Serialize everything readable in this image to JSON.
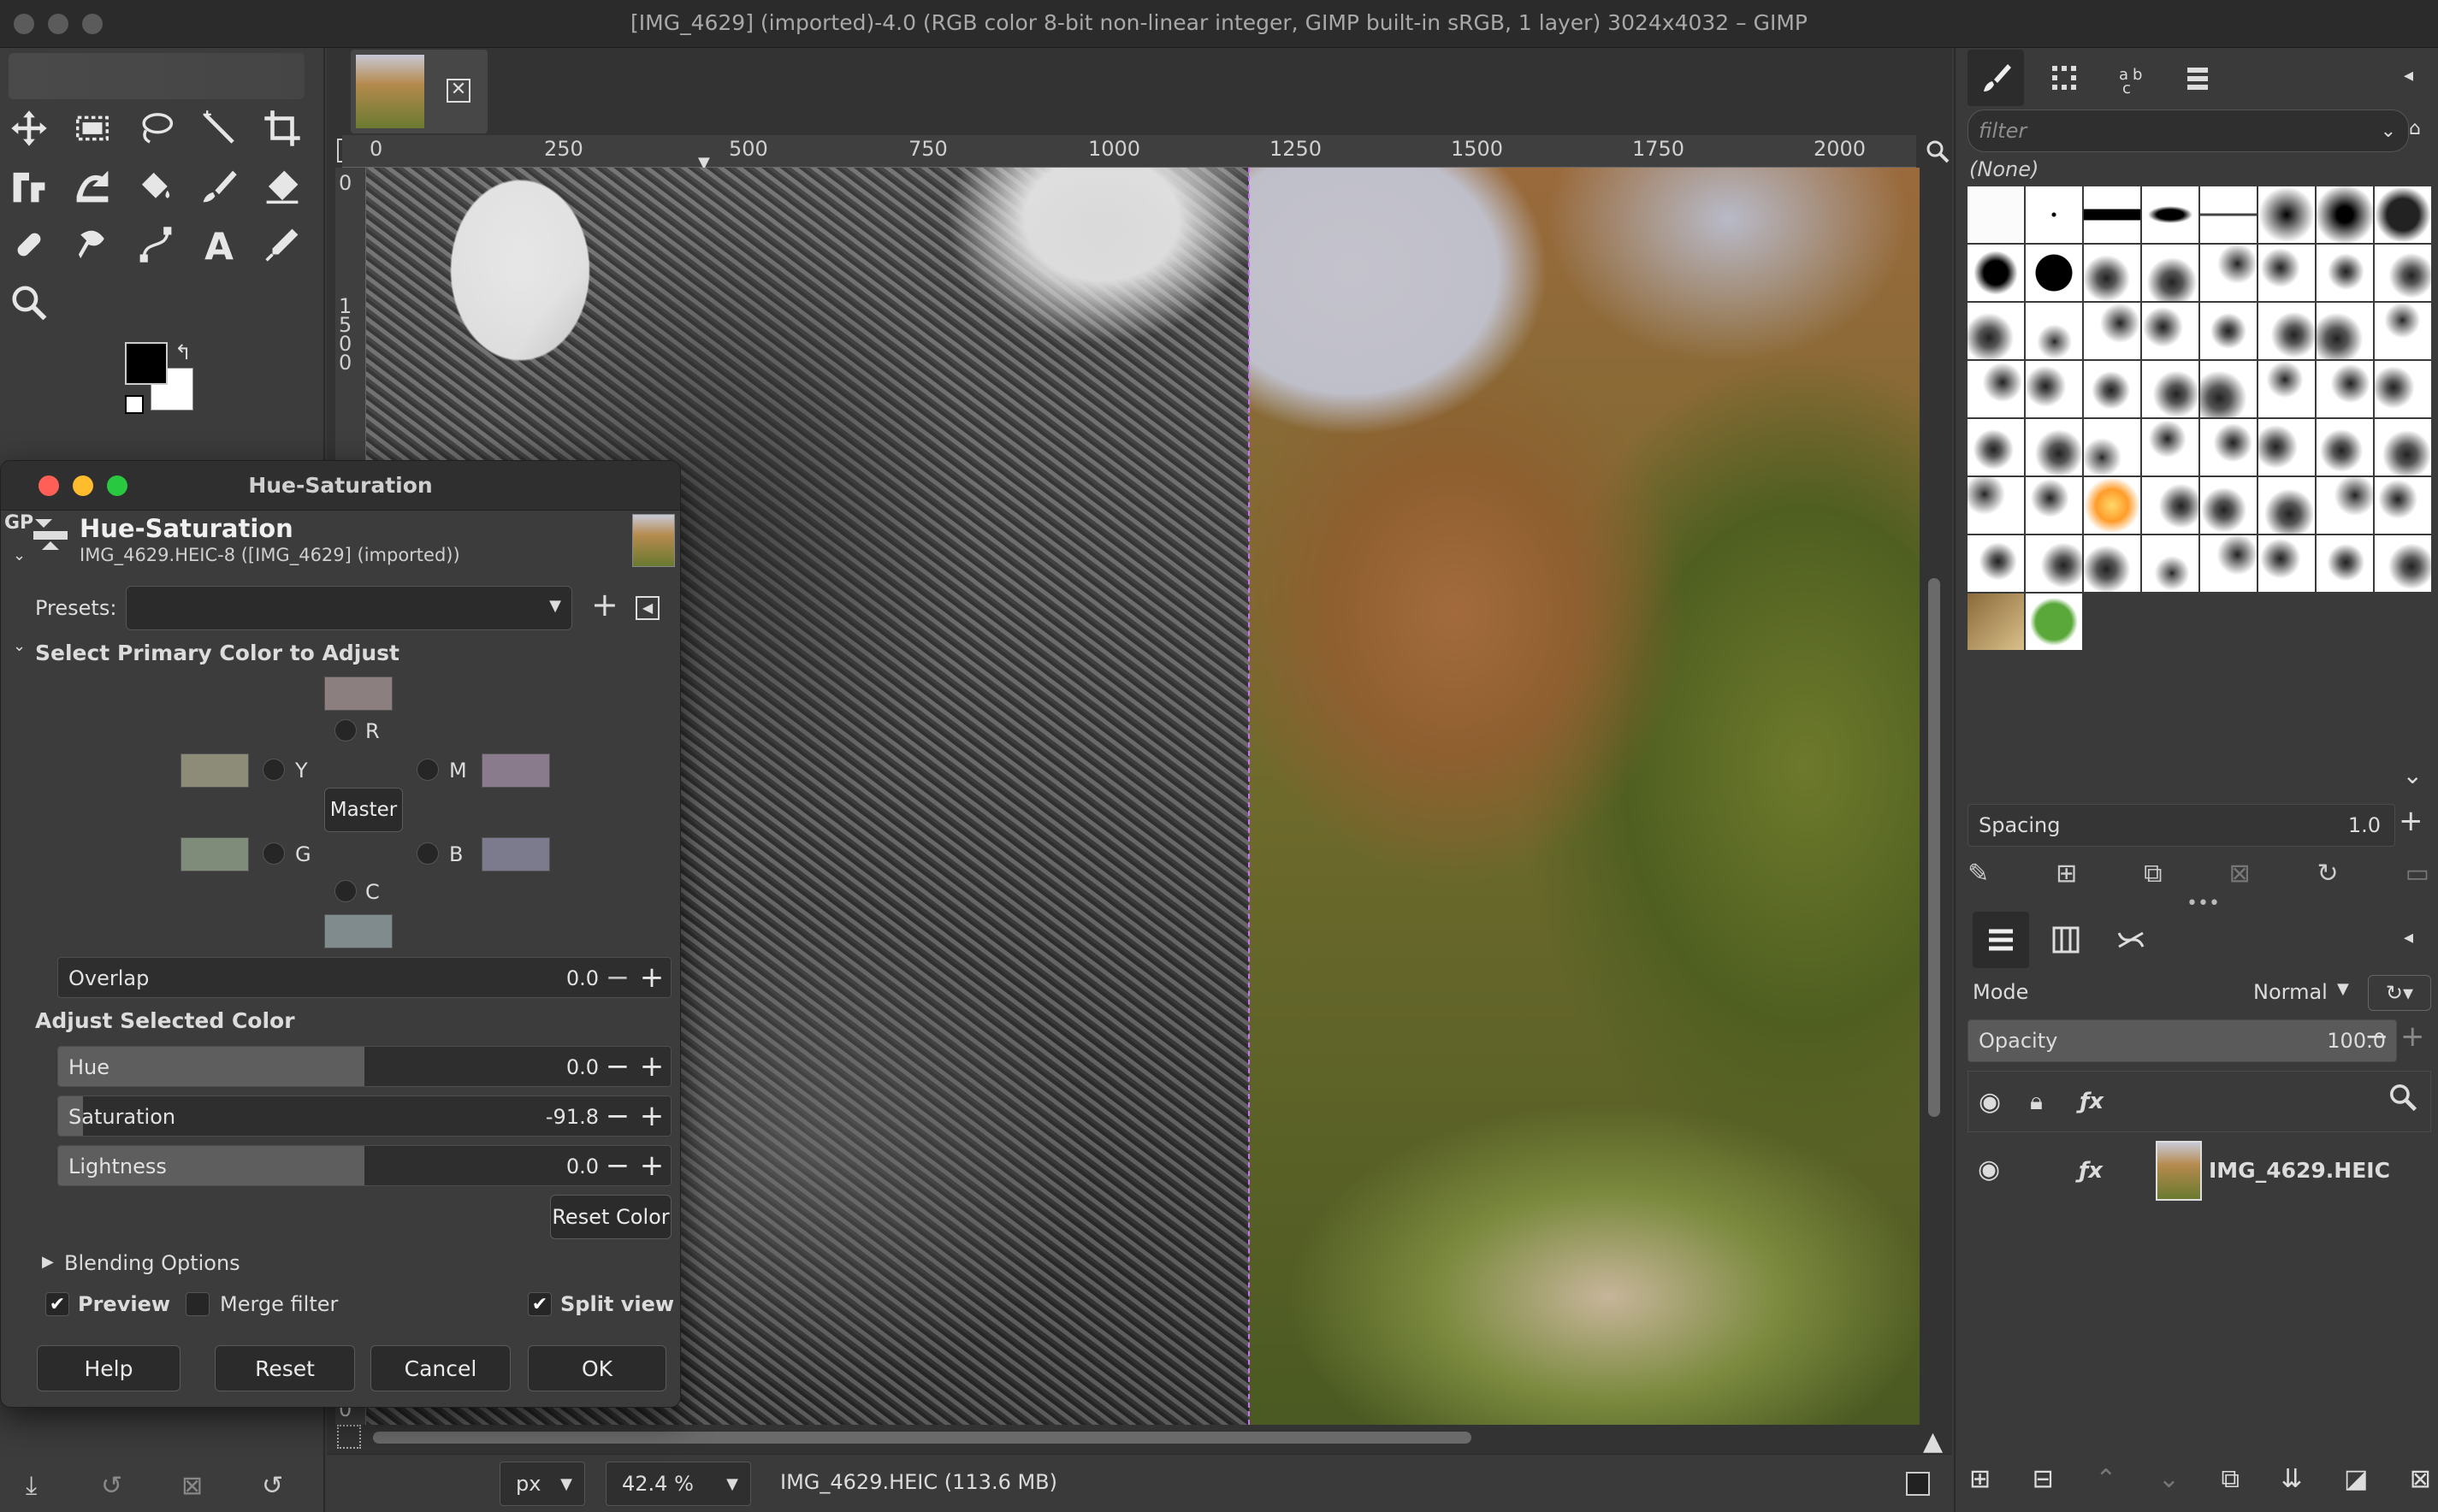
{
  "window": {
    "title": "[IMG_4629] (imported)-4.0 (RGB color 8-bit non-linear integer, GIMP built-in sRGB, 1 layer) 3024x4032 – GIMP"
  },
  "rulers": {
    "horizontal": [
      "0",
      "250",
      "500",
      "750",
      "1000",
      "1250",
      "1500",
      "1750",
      "2000"
    ],
    "vertical": [
      "0",
      "1",
      "5",
      "0",
      "0"
    ],
    "vertical_bottom": "0"
  },
  "status": {
    "unit": "px",
    "zoom": "42.4 %",
    "info": "IMG_4629.HEIC (113.6 MB)"
  },
  "dialog": {
    "title": "Hue-Saturation",
    "header": "Hue-Saturation",
    "subheader": "IMG_4629.HEIC-8 ([IMG_4629] (imported))",
    "gp_label": "GP",
    "presets_label": "Presets:",
    "presets_value": "",
    "section_primary": "Select Primary Color to Adjust",
    "colors": {
      "R": {
        "label": "R",
        "swatch": "#8c7f7f"
      },
      "Y": {
        "label": "Y",
        "swatch": "#8c8c78"
      },
      "G": {
        "label": "G",
        "swatch": "#7f8c7a"
      },
      "C": {
        "label": "C",
        "swatch": "#7f8b8c"
      },
      "B": {
        "label": "B",
        "swatch": "#7c7b8e"
      },
      "M": {
        "label": "M",
        "swatch": "#8a7b8c"
      }
    },
    "master_label": "Master",
    "overlap": {
      "label": "Overlap",
      "value": "0.0",
      "fraction": 0
    },
    "section_adjust": "Adjust Selected Color",
    "hue": {
      "label": "Hue",
      "value": "0.0",
      "fraction": 0.5
    },
    "saturation": {
      "label": "Saturation",
      "value": "-91.8",
      "fraction": 0.041
    },
    "lightness": {
      "label": "Lightness",
      "value": "0.0",
      "fraction": 0.5
    },
    "reset_color": "Reset Color",
    "blending": "Blending Options",
    "preview": {
      "label": "Preview",
      "checked": true
    },
    "merge": {
      "label": "Merge filter",
      "checked": false
    },
    "split": {
      "label": "Split view",
      "checked": true
    },
    "buttons": {
      "help": "Help",
      "reset": "Reset",
      "cancel": "Cancel",
      "ok": "OK"
    }
  },
  "brushes": {
    "filter_placeholder": "filter",
    "selected": "(None)",
    "spacing_label": "Spacing",
    "spacing_value": "1.0"
  },
  "layers": {
    "mode_label": "Mode",
    "mode_value": "Normal",
    "opacity_label": "Opacity",
    "opacity_value": "100.0",
    "layer_name": "IMG_4629.HEIC"
  },
  "colors": {
    "fg": "#000000",
    "bg": "#ffffff",
    "split_line": "#d06cff",
    "accent": "#5e5e5e"
  }
}
